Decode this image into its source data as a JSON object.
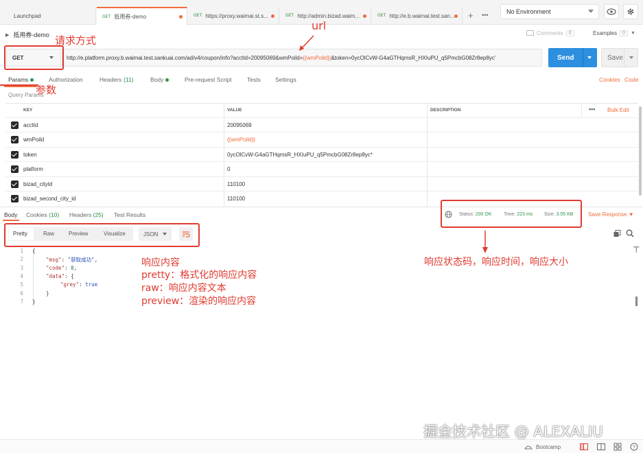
{
  "tabs": [
    {
      "label": "Launchpad",
      "method": ""
    },
    {
      "label": "抵用券-demo",
      "method": "GET"
    },
    {
      "label": "https://proxy.waimai.st.s...",
      "method": "GET"
    },
    {
      "label": "http://admin.bizad.waim...",
      "method": "GET"
    },
    {
      "label": "http://e.b.waimai.test.san...",
      "method": "GET"
    }
  ],
  "tab_tools": {
    "add": "+",
    "more": "•••"
  },
  "environment": "No Environment",
  "request": {
    "name": "抵用券-demo",
    "method": "GET",
    "url_prefix": "http://e.platform.proxy.b.waimai.test.sankuai.com/ad/v4/coupon/info?acctId=20095069&wmPoild=",
    "url_var": "{{wmPoild}}",
    "url_suffix": "&token=0ycOlCvW-G4aGTHqmsR_HXIuPU_q5PmcbG08Zr8ep8yc'",
    "send_label": "Send",
    "save_label": "Save"
  },
  "header_actions": {
    "comments": "Comments",
    "comments_count": "0",
    "examples": "Examples",
    "examples_count": "0"
  },
  "request_tabs": {
    "params": "Params",
    "authorization": "Authorization",
    "headers": "Headers",
    "headers_count": "(11)",
    "body": "Body",
    "pre_request": "Pre-request Script",
    "tests": "Tests",
    "settings": "Settings",
    "cookies": "Cookies",
    "code": "Code"
  },
  "params": {
    "section_title": "Query Params",
    "col_key": "KEY",
    "col_value": "VALUE",
    "col_desc": "DESCRIPTION",
    "more": "•••",
    "bulk_edit": "Bulk Edit",
    "rows": [
      {
        "key": "acctId",
        "value": "20095069",
        "is_var": false
      },
      {
        "key": "wmPoild",
        "value": "{{wmPoild}}",
        "is_var": true
      },
      {
        "key": "token",
        "value": "0ycOlCvW-G4aGTHqmsR_HXIuPU_q5PmcbG08Zr8ep8yc*",
        "is_var": false
      },
      {
        "key": "platform",
        "value": "0",
        "is_var": false
      },
      {
        "key": "bizad_cityId",
        "value": "110100",
        "is_var": false
      },
      {
        "key": "bizad_second_city_id",
        "value": "110100",
        "is_var": false
      }
    ]
  },
  "response_tabs": {
    "body": "Body",
    "cookies": "Cookies",
    "cookies_count": "(10)",
    "headers": "Headers",
    "headers_count": "(25)",
    "test_results": "Test Results"
  },
  "response_status": {
    "status_label": "Status:",
    "status": "200 OK",
    "time_label": "Time:",
    "time": "223 ms",
    "size_label": "Size:",
    "size": "3.05 KB",
    "save_response": "Save Response"
  },
  "response_views": {
    "pretty": "Pretty",
    "raw": "Raw",
    "preview": "Preview",
    "visualize": "Visualize",
    "format": "JSON"
  },
  "response_body": {
    "line_numbers": [
      "1",
      "2",
      "3",
      "4",
      "5",
      "6",
      "7"
    ],
    "open_brace": "{",
    "msg_key": "\"msg\"",
    "msg_value": "\"获取成功\"",
    "code_key": "\"code\"",
    "code_value": "0",
    "data_key": "\"data\"",
    "grey_key": "\"grey\"",
    "grey_value": "true",
    "inner_close": "}",
    "close_brace": "}"
  },
  "annotations": {
    "method": "请求方式",
    "url": "url",
    "params": "参数",
    "body_title": "响应内容",
    "pretty": "pretty：格式化的响应内容",
    "raw": "raw：响应内容文本",
    "preview": "preview：渲染的响应内容",
    "status": "响应状态码，响应时间，响应大小",
    "color": "#e03a2f"
  },
  "watermark": "掘金技术社区 @ ALEXALIU",
  "footer": {
    "bootcamp": "Bootcamp"
  }
}
